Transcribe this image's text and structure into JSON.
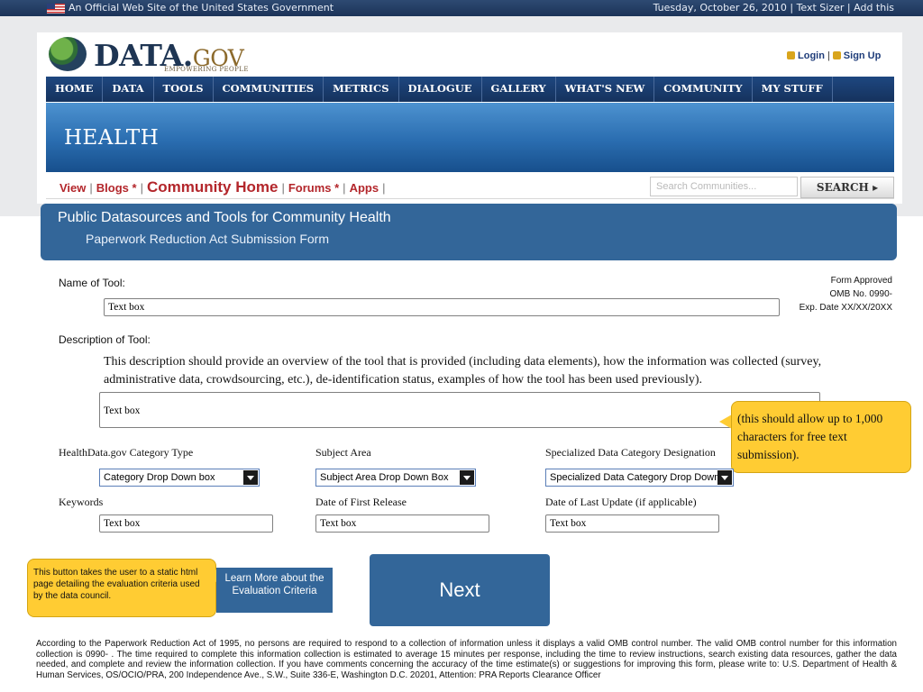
{
  "govbar": {
    "official": "An Official Web Site of the United States Government",
    "date": "Tuesday, October 26, 2010",
    "text_sizer": "Text Sizer",
    "add_this": "Add this"
  },
  "logo": {
    "brand": "DATA.",
    "brand_suffix": "GOV",
    "tagline": "EMPOWERING PEOPLE"
  },
  "account": {
    "login": "Login",
    "signup": "Sign Up"
  },
  "nav": [
    "HOME",
    "DATA",
    "TOOLS",
    "COMMUNITIES",
    "METRICS",
    "DIALOGUE",
    "GALLERY",
    "WHAT'S NEW",
    "COMMUNITY",
    "MY STUFF"
  ],
  "banner": {
    "title": "HEALTH"
  },
  "subnav": {
    "view": "View",
    "blogs": "Blogs *",
    "community_home": "Community Home",
    "forums": "Forums *",
    "apps": "Apps",
    "search_placeholder": "Search Communities...",
    "search_button": "SEARCH ▸"
  },
  "panel": {
    "title": "Public Datasources and Tools for Community Health",
    "subtitle": "Paperwork Reduction Act Submission Form"
  },
  "form": {
    "name_label": "Name of Tool:",
    "name_value": "Text box",
    "approved_1": "Form Approved",
    "approved_2": "OMB No. 0990-",
    "approved_3": "Exp. Date XX/XX/20XX",
    "desc_label": "Description of Tool:",
    "desc_help": "This description should provide an overview of the tool that is provided (including data elements), how the information was collected (survey, administrative data, crowdsourcing, etc.), de-identification status, examples of how the tool has been used previously).",
    "desc_value": "Text box",
    "category_label": "HealthData.gov Category Type",
    "category_value": "Category Drop Down box",
    "subject_label": "Subject Area",
    "subject_value": "Subject Area Drop Down Box",
    "special_label": "Specialized Data Category Designation",
    "special_value": "Specialized Data Category Drop Down",
    "keywords_label": "Keywords",
    "keywords_value": "Text box",
    "first_release_label": "Date of First Release",
    "first_release_value": "Text box",
    "last_update_label": "Date of Last Update (if applicable)",
    "last_update_value": "Text box"
  },
  "callouts": {
    "desc_limit": "(this should allow up to 1,000 characters for free text submission).",
    "learn_note": "This button takes the user to a static html page detailing the evaluation criteria used by the data council."
  },
  "buttons": {
    "learn_more": "Learn More about the Evaluation Criteria",
    "next": "Next"
  },
  "footer": {
    "pra": "According to the Paperwork Reduction Act of 1995, no persons are required to respond to a collection of information unless it displays a valid OMB control number. The valid OMB control number for this information collection is 0990- . The time required to complete this information collection is estimated to average 15 minutes per response, including the time to review instructions, search existing data resources, gather the data needed, and complete and review the information collection. If you have comments concerning the accuracy of the time estimate(s) or suggestions for improving this form, please write to:  U.S. Department of Health & Human Services, OS/OCIO/PRA, 200 Independence Ave., S.W., Suite 336-E, Washington D.C. 20201, Attention: PRA Reports Clearance Officer"
  }
}
